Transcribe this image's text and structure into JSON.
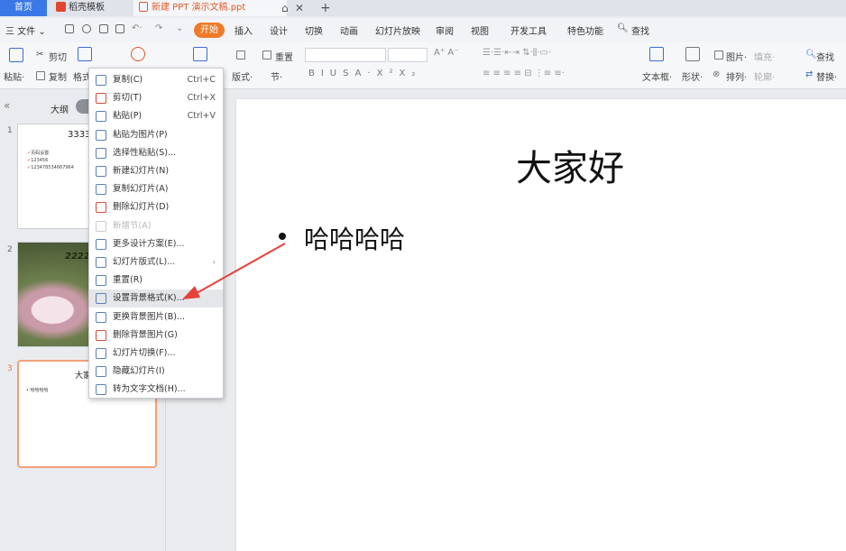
{
  "tabs": {
    "home": "首页",
    "template": "稻壳模板",
    "document": "新建 PPT 演示文稿.ppt"
  },
  "menubar": {
    "file": "三 文件 ⌄",
    "start": "开始",
    "items": [
      "插入",
      "设计",
      "切换",
      "动画",
      "幻灯片放映",
      "审阅",
      "视图",
      "开发工具",
      "特色功能"
    ],
    "search": "查找"
  },
  "ribbon": {
    "cut": "剪切",
    "paste": "粘贴·",
    "copy": "复制",
    "format": "格式",
    "layout": "版式·",
    "section": "节·",
    "reset": "重置",
    "textbox": "文本框·",
    "shape": "形状·",
    "picture": "图片·",
    "arrange": "排列·",
    "fill": "填充·",
    "outline": "轮廓·",
    "find": "查找",
    "replace": "替换·"
  },
  "leftpanel": {
    "outline_label": "大纲",
    "slides": [
      {
        "num": "1",
        "title": "33333",
        "bullets": [
          "页码设置",
          "123456",
          "123478534667964"
        ]
      },
      {
        "num": "2",
        "title": "22222"
      },
      {
        "num": "3",
        "title": "大家",
        "bullet": "• 哈哈哈哈"
      }
    ]
  },
  "slide": {
    "title": "大家好",
    "bullet": "哈哈哈哈"
  },
  "context_menu": [
    {
      "label": "复制(C)",
      "shortcut": "Ctrl+C",
      "icon": "copy-icon"
    },
    {
      "label": "剪切(T)",
      "shortcut": "Ctrl+X",
      "icon": "cut-icon"
    },
    {
      "label": "粘贴(P)",
      "shortcut": "Ctrl+V",
      "icon": "paste-icon"
    },
    {
      "label": "粘贴为图片(P)",
      "icon": "paste-image-icon"
    },
    {
      "label": "选择性粘贴(S)...",
      "icon": "paste-special-icon"
    },
    {
      "label": "新建幻灯片(N)",
      "icon": "new-slide-icon"
    },
    {
      "label": "复制幻灯片(A)",
      "icon": "duplicate-slide-icon"
    },
    {
      "label": "删除幻灯片(D)",
      "icon": "delete-slide-icon"
    },
    {
      "label": "新增节(A)",
      "icon": "new-section-icon",
      "disabled": true
    },
    {
      "label": "更多设计方案(E)...",
      "icon": "design-icon"
    },
    {
      "label": "幻灯片版式(L)...",
      "icon": "layout-icon",
      "submenu": true
    },
    {
      "label": "重置(R)",
      "icon": "reset-icon"
    },
    {
      "label": "设置背景格式(K)...",
      "icon": "background-format-icon",
      "highlighted": true
    },
    {
      "label": "更换背景图片(B)...",
      "icon": "change-background-icon"
    },
    {
      "label": "删除背景图片(G)",
      "icon": "delete-background-icon"
    },
    {
      "label": "幻灯片切换(F)...",
      "icon": "transition-icon"
    },
    {
      "label": "隐藏幻灯片(I)",
      "icon": "hide-slide-icon"
    },
    {
      "label": "转为文字文档(H)...",
      "icon": "convert-doc-icon"
    }
  ],
  "colors": {
    "accent": "#3b78e7",
    "start_button": "#f07a2b",
    "annotation_arrow": "#e8413a"
  }
}
